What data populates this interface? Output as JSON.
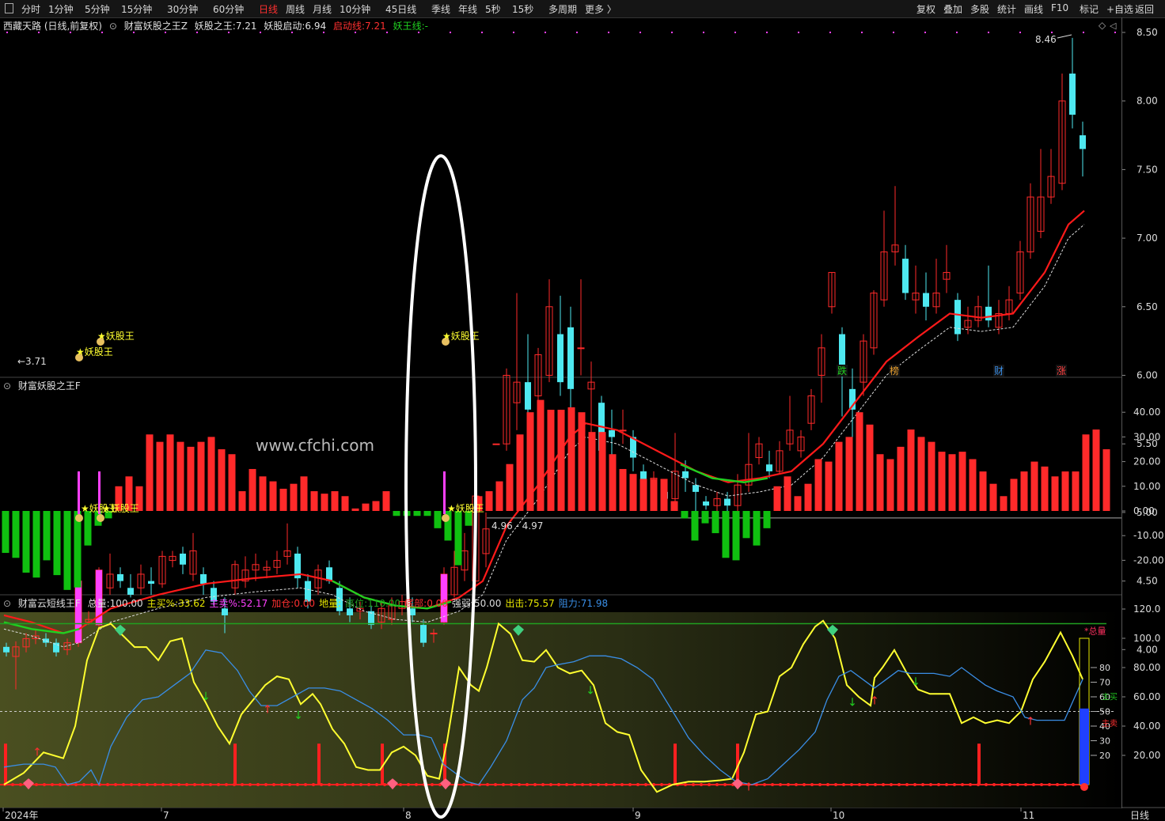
{
  "toolbar": {
    "periods": [
      "分时",
      "1分钟",
      "5分钟",
      "15分钟",
      "30分钟",
      "60分钟",
      "日线",
      "周线",
      "月线",
      "10分钟",
      "45日线",
      "季线",
      "年线",
      "5秒",
      "15秒",
      "多周期",
      "更多 〉"
    ],
    "active_period": "日线",
    "right_buttons": [
      "复权",
      "叠加",
      "多股",
      "统计",
      "画线",
      "F10",
      "标记",
      "+自选",
      "返回"
    ]
  },
  "main_pane": {
    "stock_label": "西藏天路 (日线,前复权)",
    "indicator_name": "财富妖股之王Z",
    "king_label": "妖股之王:",
    "king_value": "7.21",
    "start_label": "妖股启动:",
    "start_value": "6.94",
    "launch_label": "启动线:",
    "launch_value": "7.21",
    "wang_label": "妖王线:",
    "wang_value": "-",
    "y_ticks": [
      "8.50",
      "8.00",
      "7.50",
      "7.00",
      "6.50",
      "6.00",
      "5.50",
      "5.00",
      "4.50",
      "4.00"
    ],
    "y_values": [
      8.5,
      8.0,
      7.5,
      7.0,
      6.5,
      6.0,
      5.5,
      5.0,
      4.5,
      4.0
    ],
    "high_mark": "8.46",
    "low_mark": "3.71",
    "level_mark": "4.96 - 4.97",
    "signal_label": "妖股王",
    "event_tags": [
      "跌",
      "榜",
      "财",
      "涨"
    ]
  },
  "mid_pane": {
    "title": "财富妖股之王F",
    "watermark": "www.cfchi.com",
    "y_ticks": [
      "40.00",
      "30.00",
      "20.00",
      "10.00",
      "0.00",
      "-10.00",
      "-20.00"
    ],
    "signal_label": "妖股王"
  },
  "bottom_pane": {
    "title": "财富云短线王F",
    "items": [
      {
        "label": "总量:",
        "value": "100.00",
        "color": "#dddddd"
      },
      {
        "label": "主买%:",
        "value": "33.62",
        "color": "#e8e800"
      },
      {
        "label": "主卖%:",
        "value": "52.17",
        "color": "#ff40ff"
      },
      {
        "label": "加仓:",
        "value": "0.00",
        "color": "#ff3030"
      },
      {
        "label": "地量:",
        "value": "",
        "color": "#e8e800"
      },
      {
        "label": "高位:",
        "value": "110.00",
        "color": "#20a020"
      },
      {
        "label": "底部:",
        "value": "0.00",
        "color": "#ff3030"
      },
      {
        "label": "强弱:",
        "value": "50.00",
        "color": "#dddddd"
      },
      {
        "label": "出击:",
        "value": "75.57",
        "color": "#e8e800"
      },
      {
        "label": "阻力:",
        "value": "71.98",
        "color": "#3a8ee6"
      }
    ],
    "y_ticks": [
      "120.0",
      "100.0",
      "80.00",
      "60.00",
      "40.00",
      "20.00"
    ],
    "gauge_title": "*总量",
    "gauge_ticks": [
      "80",
      "70",
      "60",
      "50",
      "40",
      "30",
      "20"
    ],
    "gauge_buy": "主买",
    "gauge_sell": "主卖"
  },
  "x_axis": {
    "labels": [
      "2024年",
      "7",
      "8",
      "9",
      "10",
      "11"
    ],
    "period_label": "日线"
  },
  "colors": {
    "up": "#ff2a2a",
    "down": "#4ee8f0",
    "ma_up": "#ff1a1a",
    "ma_down": "#20d020",
    "magenta": "#ff40ff",
    "yellow": "#ffff30",
    "blue": "#3a8ee6",
    "green": "#10c010"
  }
}
